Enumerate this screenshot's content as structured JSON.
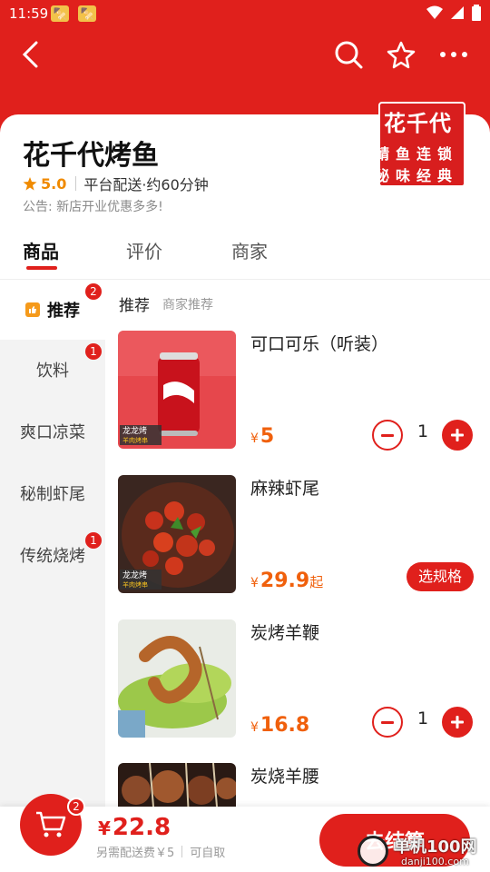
{
  "status_bar": {
    "time": "11:59"
  },
  "store": {
    "name": "花千代烤鱼",
    "rating": "5.0",
    "delivery": "平台配送·约60分钟",
    "notice": "公告: 新店开业优惠多多!",
    "logo_line1": "花千代",
    "logo_line2": "鲭鱼连锁",
    "logo_line3": "秘味经典"
  },
  "tabs": [
    {
      "label": "商品",
      "active": true
    },
    {
      "label": "评价",
      "active": false
    },
    {
      "label": "商家",
      "active": false
    }
  ],
  "sidebar": {
    "items": [
      {
        "label": "推荐",
        "badge": "2",
        "active": true
      },
      {
        "label": "饮料",
        "badge": "1"
      },
      {
        "label": "爽口凉菜",
        "badge": ""
      },
      {
        "label": "秘制虾尾",
        "badge": ""
      },
      {
        "label": "传统烧烤",
        "badge": "1"
      }
    ]
  },
  "section": {
    "title": "推荐",
    "subtitle": "商家推荐"
  },
  "products": [
    {
      "name": "可口可乐（听装）",
      "currency": "¥",
      "price": "5",
      "qty": "1",
      "img_label_1": "龙龙烤",
      "img_label_2": "羊肉烤串"
    },
    {
      "name": "麻辣虾尾",
      "currency": "¥",
      "price": "29.9",
      "price_suffix": "起",
      "spec_button": "选规格",
      "img_label_1": "龙龙烤",
      "img_label_2": "羊肉烤串"
    },
    {
      "name": "炭烤羊鞭",
      "currency": "¥",
      "price": "16.8",
      "qty": "1"
    },
    {
      "name": "炭烧羊腰"
    }
  ],
  "cart": {
    "badge": "2",
    "currency": "¥",
    "total": "22.8",
    "extra_fee": "另需配送费￥5",
    "pickup": "可自取",
    "checkout_label": "去结算"
  },
  "watermark": {
    "text": "单机100网",
    "url": "danji100.com"
  },
  "colors": {
    "brand_red": "#e0201c",
    "price_orange": "#f0600c",
    "star": "#f08a00"
  }
}
